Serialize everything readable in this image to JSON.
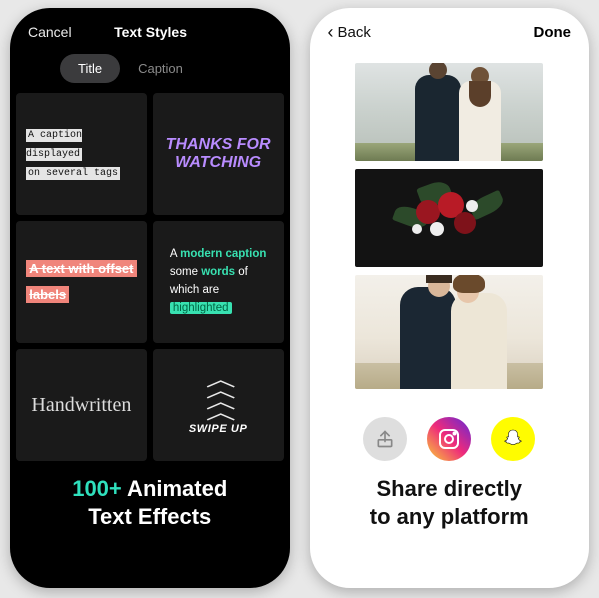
{
  "left": {
    "header": {
      "cancel": "Cancel",
      "title": "Text Styles"
    },
    "tabs": {
      "title": "Title",
      "caption": "Caption"
    },
    "tiles": {
      "caption_l1": "A caption displayed",
      "caption_l2": "on several tags",
      "thanks_l1": "THANKS FOR",
      "thanks_l2": "WATCHING",
      "offset_l1": "A text with offset",
      "offset_l2": "labels",
      "modern_l1a": "A ",
      "modern_l1b": "modern caption",
      "modern_l2a": "some ",
      "modern_l2b": "words",
      "modern_l2c": " of",
      "modern_l3": "which are",
      "modern_l4": "highlighted",
      "handwritten": "Handwritten",
      "swipe": "SWIPE UP"
    },
    "headline_accent": "100+",
    "headline_rest": " Animated\nText Effects"
  },
  "right": {
    "header": {
      "back": "Back",
      "done": "Done"
    },
    "icons": {
      "share": "share-icon",
      "instagram": "instagram-icon",
      "snapchat": "snapchat-icon"
    },
    "headline": "Share directly\nto any platform"
  }
}
